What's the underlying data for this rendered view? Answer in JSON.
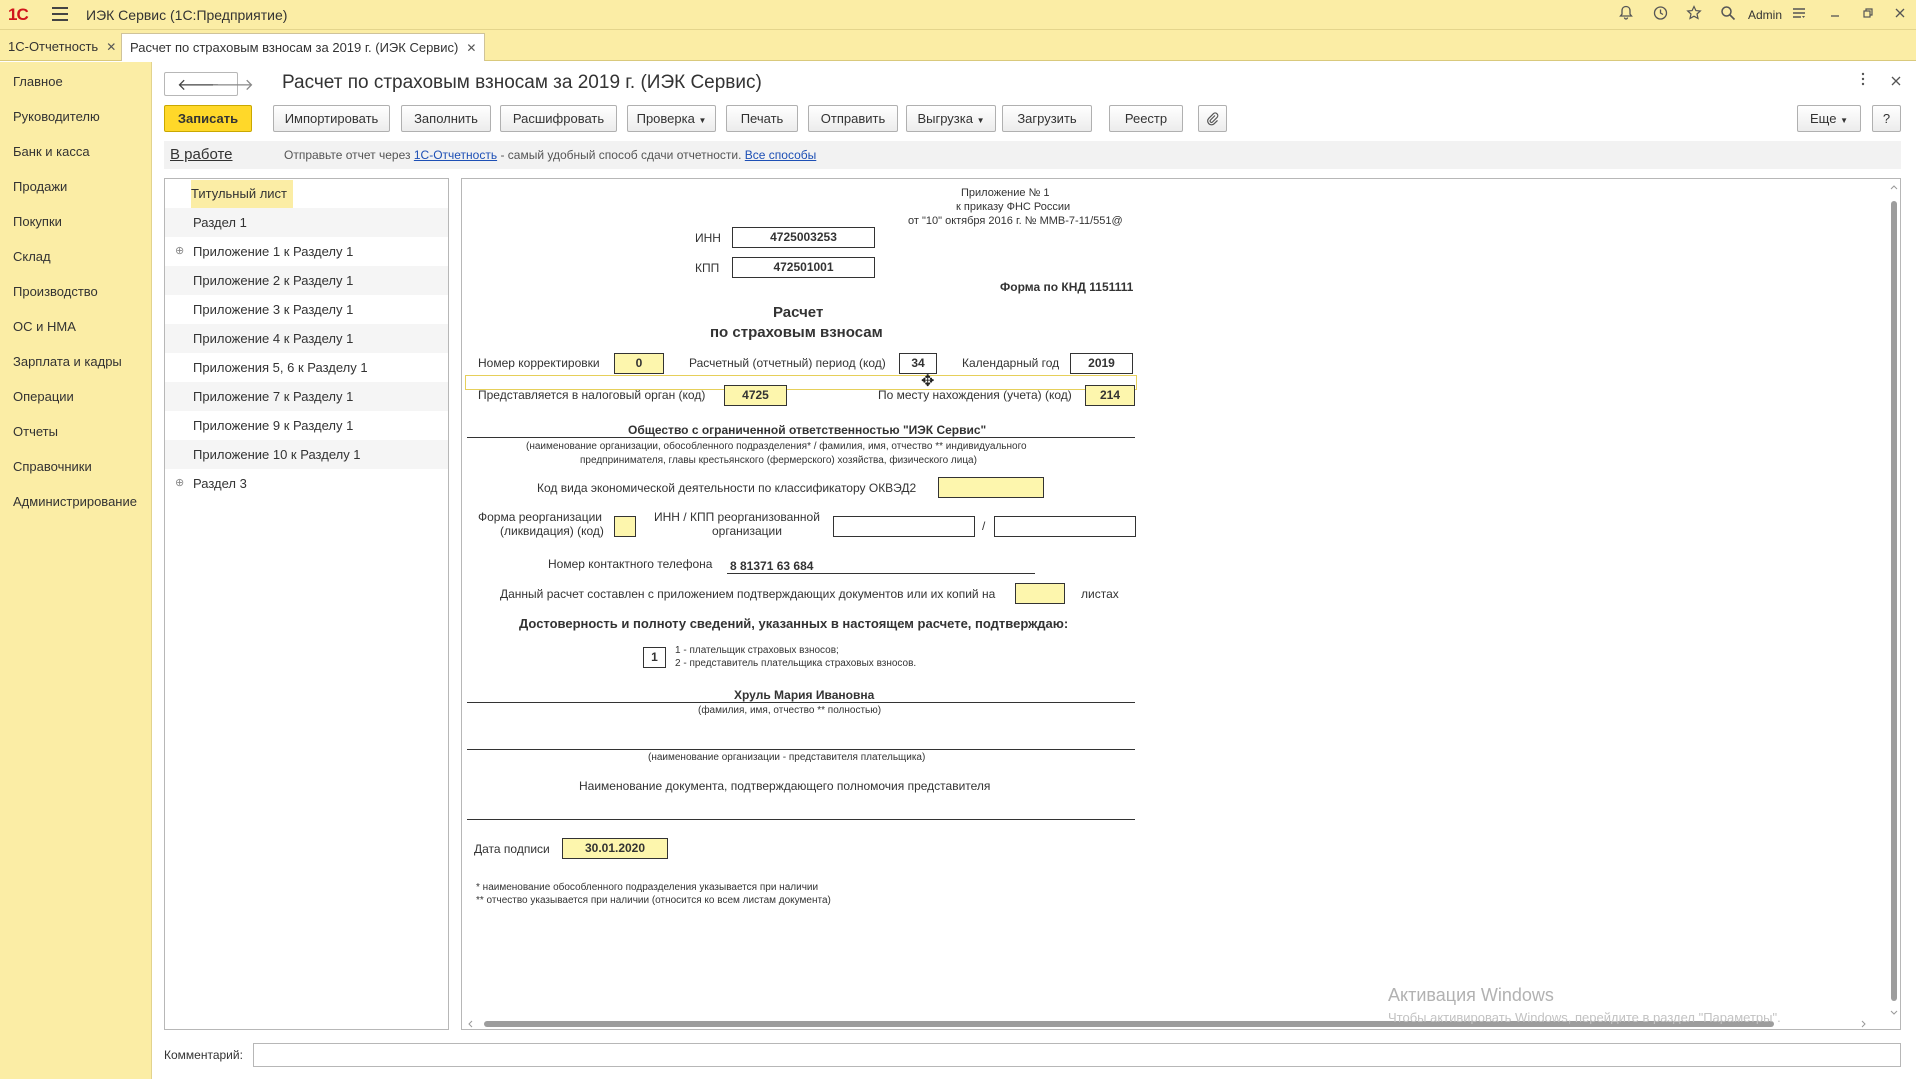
{
  "titlebar": {
    "logo": "1С",
    "app_title": "ИЭК Сервис  (1С:Предприятие)",
    "user": "Admin"
  },
  "tabs": [
    {
      "label": "1С-Отчетность"
    },
    {
      "label": "Расчет по страховым взносам за 2019 г. (ИЭК Сервис)"
    }
  ],
  "sidebar": {
    "items": [
      {
        "label": "Главное"
      },
      {
        "label": "Руководителю"
      },
      {
        "label": "Банк и касса"
      },
      {
        "label": "Продажи"
      },
      {
        "label": "Покупки"
      },
      {
        "label": "Склад"
      },
      {
        "label": "Производство"
      },
      {
        "label": "ОС и НМА"
      },
      {
        "label": "Зарплата и кадры"
      },
      {
        "label": "Операции"
      },
      {
        "label": "Отчеты"
      },
      {
        "label": "Справочники"
      },
      {
        "label": "Администрирование"
      }
    ]
  },
  "document": {
    "title": "Расчет по страховым взносам за 2019 г. (ИЭК Сервис)"
  },
  "toolbar": {
    "save": "Записать",
    "import": "Импортировать",
    "fill": "Заполнить",
    "decode": "Расшифровать",
    "check": "Проверка",
    "print": "Печать",
    "send": "Отправить",
    "export": "Выгрузка",
    "load": "Загрузить",
    "registry": "Реестр",
    "more": "Еще",
    "help": "?"
  },
  "status": {
    "state": "В работе",
    "msg_prefix": "Отправьте отчет через",
    "link1": "1С-Отчетность",
    "msg_middle": " - самый удобный способ сдачи отчетности.",
    "link2": "Все способы"
  },
  "tree": {
    "items": [
      {
        "label": "Титульный лист"
      },
      {
        "label": "Раздел 1"
      },
      {
        "label": "Приложение 1 к Разделу 1"
      },
      {
        "label": "Приложение 2 к Разделу 1"
      },
      {
        "label": "Приложение 3 к Разделу 1"
      },
      {
        "label": "Приложение 4 к Разделу 1"
      },
      {
        "label": "Приложения 5, 6 к Разделу 1"
      },
      {
        "label": "Приложение 7 к Разделу 1"
      },
      {
        "label": "Приложение 9 к Разделу 1"
      },
      {
        "label": "Приложение 10 к Разделу 1"
      },
      {
        "label": "Раздел 3"
      }
    ]
  },
  "form": {
    "appendix_line1": "Приложение № 1",
    "appendix_line2": "к приказу ФНС России",
    "appendix_line3": "от \"10\" октября 2016 г. № ММВ-7-11/551@",
    "inn_label": "ИНН",
    "inn_value": "4725003253",
    "kpp_label": "КПП",
    "kpp_value": "472501001",
    "knd": "Форма по КНД 1151111",
    "heading1": "Расчет",
    "heading2": "по страховым взносам",
    "corr_label": "Номер корректировки",
    "corr_value": "0",
    "period_label": "Расчетный (отчетный) период (код)",
    "period_value": "34",
    "year_label": "Календарный год",
    "year_value": "2019",
    "tax_label": "Представляется в налоговый орган (код)",
    "tax_value": "4725",
    "place_label": "По месту нахождения (учета) (код)",
    "place_value": "214",
    "org_name": "Общество с ограниченной ответственностью \"ИЭК Сервис\"",
    "org_note1": "(наименование организации, обособленного подразделения* / фамилия, имя, отчество ** индивидуального",
    "org_note2": "предпринимателя, главы крестьянского (фермерского) хозяйства, физического лица)",
    "okved_label": "Код вида экономической деятельности по классификатору ОКВЭД2",
    "okved_value": "",
    "reorg_label1": "Форма реорганизации",
    "reorg_label2": "(ликвидация) (код)",
    "reorg_inn_label1": "ИНН / КПП реорганизованной",
    "reorg_inn_label2": "организации",
    "slash": "/",
    "phone_label": "Номер контактного телефона",
    "phone_value": "8 81371 63 684",
    "pages_label": "Данный расчет составлен с приложением подтверждающих документов или их копий на",
    "pages_suffix": "листах",
    "confirm_heading": "Достоверность и полноту сведений, указанных в настоящем расчете, подтверждаю:",
    "confirm_code": "1",
    "confirm_opt1": "1 - плательщик страховых взносов;",
    "confirm_opt2": "2 - представитель плательщика страховых взносов.",
    "signer_name": "Хруль Мария Ивановна",
    "signer_note": "(фамилия, имя, отчество **  полностью)",
    "rep_note": "(наименование организации - представителя плательщика)",
    "doc_label": "Наименование документа, подтверждающего полномочия представителя",
    "date_label": "Дата подписи",
    "date_value": "30.01.2020",
    "footnote1": "*  наименование обособленного подразделения указывается при наличии",
    "footnote2": "** отчество указывается при наличии (относится ко всем листам документа)"
  },
  "comment": {
    "label": "Комментарий:",
    "value": ""
  },
  "watermark": {
    "line1": "Активация Windows",
    "line2": "Чтобы активировать Windows, перейдите в раздел \"Параметры\"."
  }
}
